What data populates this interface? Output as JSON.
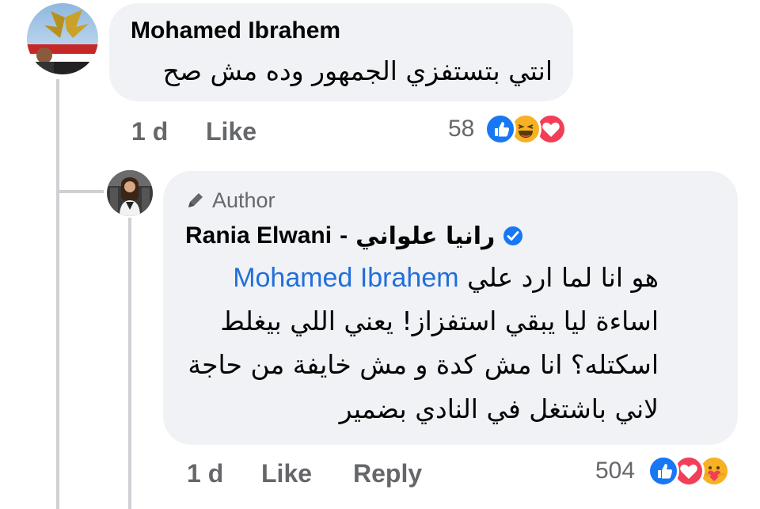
{
  "comment": {
    "author": "Mohamed Ibrahem",
    "text": "انتي بتستفزي الجمهور وده مش صح",
    "time": "1 d",
    "like_label": "Like",
    "reaction_count": "58",
    "reactions": [
      "like-icon",
      "haha-icon",
      "love-icon"
    ]
  },
  "reply": {
    "badge": "Author",
    "author_latin": "Rania Elwani",
    "author_sep": "-",
    "author_arabic": "رانيا علواني",
    "line1_text": "هو انا لما ارد علي",
    "mention": "Mohamed Ibrahem",
    "line2": "اساءة ليا يبقي استفزاز! يعني اللي بيغلط",
    "line3": "اسكتله؟ انا مش كدة و مش خايفة من حاجة",
    "line4": "لاني باشتغل في النادي بضمير",
    "time": "1 d",
    "like_label": "Like",
    "reply_label": "Reply",
    "reaction_count": "504",
    "reactions": [
      "like-icon",
      "love-icon",
      "care-icon"
    ]
  },
  "colors": {
    "bubble": "#f0f2f5",
    "meta_text": "#65676b",
    "mention": "#216fdb",
    "like_blue": "#1877f2",
    "love_red": "#f33e58",
    "haha_yellow": "#f7b125",
    "verified_blue": "#1877f2"
  }
}
